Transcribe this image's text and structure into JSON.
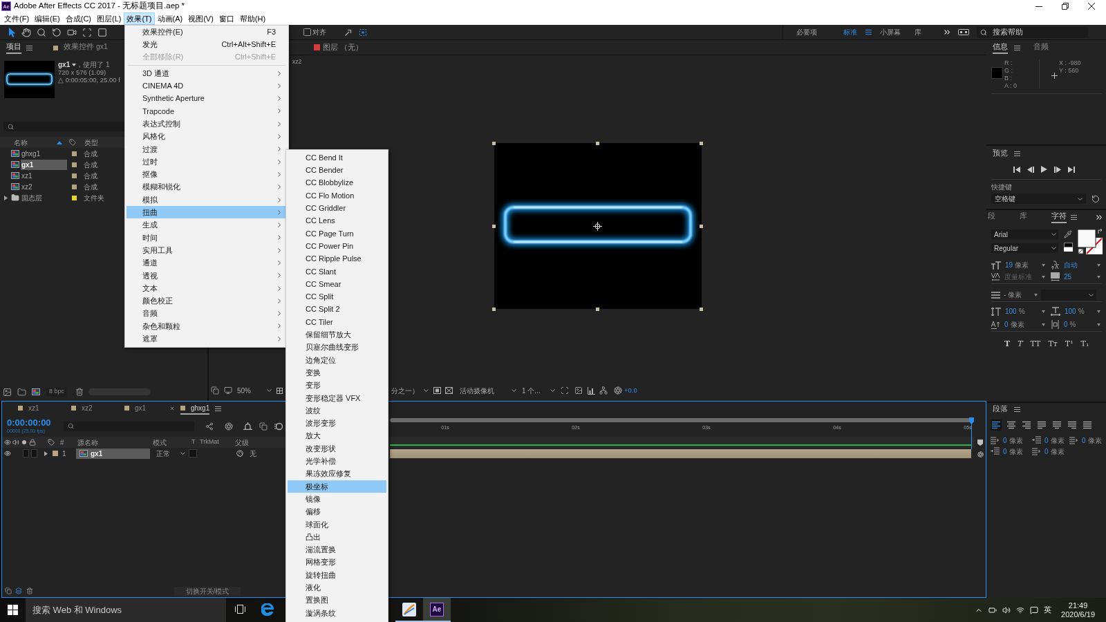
{
  "window": {
    "app_icon": "Ae",
    "title": "Adobe After Effects CC 2017 - 无标题项目.aep *"
  },
  "menubar": [
    {
      "label": "文件(F)",
      "selected": false
    },
    {
      "label": "编辑(E)",
      "selected": false
    },
    {
      "label": "合成(C)",
      "selected": false
    },
    {
      "label": "图层(L)",
      "selected": false
    },
    {
      "label": "效果(T)",
      "selected": true
    },
    {
      "label": "动画(A)",
      "selected": false
    },
    {
      "label": "视图(V)",
      "selected": false
    },
    {
      "label": "窗口",
      "selected": false
    },
    {
      "label": "帮助(H)",
      "selected": false
    }
  ],
  "toolbar": {
    "tools": [
      {
        "kind": "selection",
        "selected": true
      },
      {
        "kind": "hand",
        "selected": false
      },
      {
        "kind": "zoom",
        "selected": false
      },
      {
        "kind": "rotate",
        "selected": false
      },
      {
        "kind": "camera",
        "selected": false
      },
      {
        "kind": "pan-behind",
        "selected": false
      },
      {
        "kind": "rectangle",
        "selected": false
      }
    ],
    "snap": {
      "label": "对齐",
      "checked": false
    },
    "workspaces": [
      {
        "label": "必要项",
        "selected": false
      },
      {
        "label": "标准",
        "selected": true
      },
      {
        "label": "小屏幕",
        "selected": false
      },
      {
        "label": "库",
        "selected": false
      }
    ],
    "help_search": {
      "placeholder": "搜索帮助"
    }
  },
  "project_panel": {
    "tabs": [
      {
        "label": "项目",
        "selected": true
      },
      {
        "label": "效果控件 gx1",
        "selected": false
      }
    ],
    "preview": {
      "name": "gx1",
      "usage": "，使用了 1",
      "size": "720 x 576 (1.09)",
      "duration": "△ 0:00:05:00, 25.00 f"
    },
    "columns": [
      "名称",
      "类型"
    ],
    "items": [
      {
        "kind": "comp",
        "name": "ghxg1",
        "type": "合成",
        "color": "#b5a482",
        "selected": false
      },
      {
        "kind": "comp",
        "name": "gx1",
        "type": "合成",
        "color": "#b5a482",
        "selected": true
      },
      {
        "kind": "comp",
        "name": "xz1",
        "type": "合成",
        "color": "#b5a482",
        "selected": false
      },
      {
        "kind": "comp",
        "name": "xz2",
        "type": "合成",
        "color": "#b5a482",
        "selected": false
      },
      {
        "kind": "folder",
        "name": "固态层",
        "type": "文件夹",
        "color": "#e5d534",
        "selected": false,
        "expanded": false
      }
    ],
    "bit_depth": "8 bpc"
  },
  "composition_panel": {
    "layer_tab": "图层 （无）",
    "breadcrumb": "xz2",
    "zoom": "50%",
    "resolution": "分之一）",
    "camera": "活动摄像机",
    "views": "1 个...",
    "exposure": "+0.0"
  },
  "info_panel": {
    "tabs": [
      {
        "label": "信息",
        "selected": true
      },
      {
        "label": "音频",
        "selected": false
      }
    ],
    "color_values": [
      "R :",
      "G :",
      "B :",
      "A : 0"
    ],
    "position": [
      "X : -980",
      "Y : 560"
    ]
  },
  "preview_panel": {
    "title": "预览",
    "shortcut_label": "快捷键",
    "shortcut": "空格键"
  },
  "character_panel": {
    "tabs": [
      {
        "label": "段",
        "selected": false
      },
      {
        "label": "库",
        "selected": false
      },
      {
        "label": "字符",
        "selected": true
      }
    ],
    "font": "Arial",
    "style": "Regular",
    "metrics": [
      {
        "kind": "font-size",
        "value": "19",
        "unit": "像素",
        "disabled": false
      },
      {
        "kind": "leading",
        "value": "自动",
        "disabled": false
      },
      {
        "kind": "kerning",
        "value": "度量标准",
        "disabled": true
      },
      {
        "kind": "tracking",
        "value": "25",
        "disabled": false
      }
    ],
    "stroke": {
      "value": "- 像素",
      "disabled": true
    },
    "scales": [
      {
        "kind": "vertical-scale",
        "value": "100",
        "unit": "%",
        "disabled": false
      },
      {
        "kind": "horizontal-scale",
        "value": "100",
        "unit": "%",
        "disabled": false
      },
      {
        "kind": "baseline-shift",
        "value": "0",
        "unit": "像素",
        "disabled": false
      },
      {
        "kind": "tsume",
        "value": "0",
        "unit": "%",
        "disabled": false
      }
    ],
    "styles": [
      {
        "kind": "faux-bold",
        "label": "T"
      },
      {
        "kind": "faux-italic",
        "label": "T"
      },
      {
        "kind": "all-caps",
        "label": "TT"
      },
      {
        "kind": "small-caps",
        "label": "Tᴛ"
      },
      {
        "kind": "superscript",
        "label": "T¹"
      },
      {
        "kind": "subscript",
        "label": "T₁"
      }
    ]
  },
  "paragraph_panel": {
    "title": "段落",
    "alignments": [
      {
        "kind": "left",
        "selected": true
      },
      {
        "kind": "center",
        "selected": false
      },
      {
        "kind": "right",
        "selected": false
      },
      {
        "kind": "justify-left",
        "selected": false
      },
      {
        "kind": "justify-center",
        "selected": false
      },
      {
        "kind": "justify-right",
        "selected": false
      },
      {
        "kind": "justify-all",
        "selected": false
      }
    ],
    "indents": [
      {
        "value": "0",
        "unit": "像素"
      },
      {
        "value": "0",
        "unit": "像素"
      },
      {
        "value": "0",
        "unit": "像素"
      },
      {
        "value": "0",
        "unit": "像素"
      },
      {
        "value": "0",
        "unit": "像素"
      }
    ]
  },
  "timeline": {
    "tabs": [
      {
        "label": "xz1",
        "selected": false
      },
      {
        "label": "xz2",
        "selected": false
      },
      {
        "label": "gx1",
        "selected": false
      },
      {
        "label": "ghxg1",
        "selected": true
      }
    ],
    "timecode": "0:00:00:00",
    "frame_info": "00000 (25.00 fps)",
    "columns": [
      "#",
      "源名称",
      "模式",
      "T",
      "TrkMat",
      "父级"
    ],
    "layers": [
      {
        "index": "1",
        "name": "gx1",
        "mode": "正常",
        "parent": "无",
        "visible": true,
        "selected": true
      }
    ],
    "ruler": [
      "01s",
      "02s",
      "03s",
      "04s",
      "05s"
    ],
    "footer": "切换开关/模式"
  },
  "effects_menu": {
    "items": [
      {
        "kind": "command",
        "label": "效果控件(E)",
        "shortcut": "F3",
        "disabled": false,
        "selected": false
      },
      {
        "kind": "command",
        "label": "发光",
        "shortcut": "Ctrl+Alt+Shift+E",
        "disabled": false,
        "selected": false
      },
      {
        "kind": "command",
        "label": "全部移除(R)",
        "shortcut": "Ctrl+Shift+E",
        "disabled": true,
        "selected": false
      },
      {
        "kind": "separator"
      },
      {
        "kind": "submenu",
        "label": "3D 通道",
        "selected": false
      },
      {
        "kind": "submenu",
        "label": "CINEMA 4D",
        "selected": false
      },
      {
        "kind": "submenu",
        "label": "Synthetic Aperture",
        "selected": false
      },
      {
        "kind": "submenu",
        "label": "Trapcode",
        "selected": false
      },
      {
        "kind": "submenu",
        "label": "表达式控制",
        "selected": false
      },
      {
        "kind": "submenu",
        "label": "风格化",
        "selected": false
      },
      {
        "kind": "submenu",
        "label": "过渡",
        "selected": false
      },
      {
        "kind": "submenu",
        "label": "过时",
        "selected": false
      },
      {
        "kind": "submenu",
        "label": "抠像",
        "selected": false
      },
      {
        "kind": "submenu",
        "label": "模糊和锐化",
        "selected": false
      },
      {
        "kind": "submenu",
        "label": "模拟",
        "selected": false
      },
      {
        "kind": "submenu",
        "label": "扭曲",
        "selected": true
      },
      {
        "kind": "submenu",
        "label": "生成",
        "selected": false
      },
      {
        "kind": "submenu",
        "label": "时间",
        "selected": false
      },
      {
        "kind": "submenu",
        "label": "实用工具",
        "selected": false
      },
      {
        "kind": "submenu",
        "label": "通道",
        "selected": false
      },
      {
        "kind": "submenu",
        "label": "透视",
        "selected": false
      },
      {
        "kind": "submenu",
        "label": "文本",
        "selected": false
      },
      {
        "kind": "submenu",
        "label": "颜色校正",
        "selected": false
      },
      {
        "kind": "submenu",
        "label": "音频",
        "selected": false
      },
      {
        "kind": "submenu",
        "label": "杂色和颗粒",
        "selected": false
      },
      {
        "kind": "submenu",
        "label": "遮罩",
        "selected": false
      }
    ]
  },
  "distort_submenu": {
    "items": [
      {
        "label": "CC Bend It",
        "selected": false
      },
      {
        "label": "CC Bender",
        "selected": false
      },
      {
        "label": "CC Blobbylize",
        "selected": false
      },
      {
        "label": "CC Flo Motion",
        "selected": false
      },
      {
        "label": "CC Griddler",
        "selected": false
      },
      {
        "label": "CC Lens",
        "selected": false
      },
      {
        "label": "CC Page Turn",
        "selected": false
      },
      {
        "label": "CC Power Pin",
        "selected": false
      },
      {
        "label": "CC Ripple Pulse",
        "selected": false
      },
      {
        "label": "CC Slant",
        "selected": false
      },
      {
        "label": "CC Smear",
        "selected": false
      },
      {
        "label": "CC Split",
        "selected": false
      },
      {
        "label": "CC Split 2",
        "selected": false
      },
      {
        "label": "CC Tiler",
        "selected": false
      },
      {
        "label": "保留细节放大",
        "selected": false
      },
      {
        "label": "贝塞尔曲线变形",
        "selected": false
      },
      {
        "label": "边角定位",
        "selected": false
      },
      {
        "label": "变换",
        "selected": false
      },
      {
        "label": "变形",
        "selected": false
      },
      {
        "label": "变形稳定器 VFX",
        "selected": false
      },
      {
        "label": "波纹",
        "selected": false
      },
      {
        "label": "波形变形",
        "selected": false
      },
      {
        "label": "放大",
        "selected": false
      },
      {
        "label": "改变形状",
        "selected": false
      },
      {
        "label": "光学补偿",
        "selected": false
      },
      {
        "label": "果冻效应修复",
        "selected": false
      },
      {
        "label": "极坐标",
        "selected": true
      },
      {
        "label": "镜像",
        "selected": false
      },
      {
        "label": "偏移",
        "selected": false
      },
      {
        "label": "球面化",
        "selected": false
      },
      {
        "label": "凸出",
        "selected": false
      },
      {
        "label": "湍流置换",
        "selected": false
      },
      {
        "label": "网格变形",
        "selected": false
      },
      {
        "label": "旋转扭曲",
        "selected": false
      },
      {
        "label": "液化",
        "selected": false
      },
      {
        "label": "置换图",
        "selected": false
      },
      {
        "label": "漩涡条纹",
        "selected": false
      }
    ]
  },
  "taskbar": {
    "search_placeholder": "搜索 Web 和 Windows",
    "apps": [
      {
        "kind": "task-view",
        "open": false,
        "active": false
      },
      {
        "kind": "browser",
        "open": false,
        "active": false
      },
      {
        "kind": "paint",
        "open": true,
        "active": false
      },
      {
        "kind": "after-effects",
        "label": "Ae",
        "open": true,
        "active": true
      }
    ],
    "ime": "英",
    "time": "21:49",
    "date": "2020/6/19"
  }
}
